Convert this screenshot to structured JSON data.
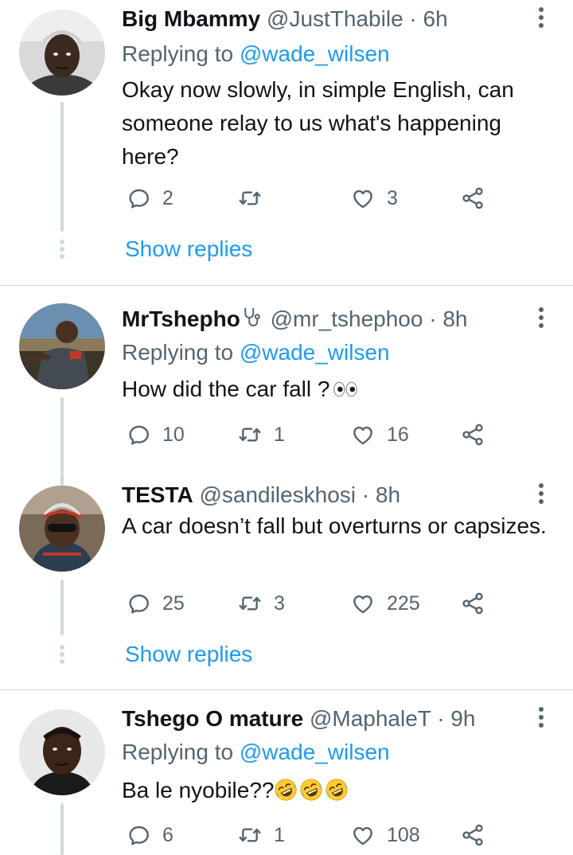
{
  "tweets": [
    {
      "name": "Big Mbammy",
      "handle": "@JustThabile",
      "time": "· 6h",
      "replying_prefix": "Replying to",
      "replying_to": "@wade_wilsen",
      "text": "Okay now slowly, in simple English, can someone relay to us what's happening here?",
      "replies": "2",
      "retweets": "",
      "likes": "3",
      "show_replies": "Show replies"
    },
    {
      "name": "MrTshepho",
      "name_emoji": "stethoscope-emoji",
      "handle": "@mr_tshephoo",
      "time": "· 8h",
      "replying_prefix": "Replying to",
      "replying_to": "@wade_wilsen",
      "text": "How did the car fall ?",
      "text_emoji": "eyes-emoji",
      "replies": "10",
      "retweets": "1",
      "likes": "16"
    },
    {
      "name": "TESTA",
      "handle": "@sandileskhosi",
      "time": "· 8h",
      "text": "A car doesn’t fall but overturns or capsizes.",
      "replies": "25",
      "retweets": "3",
      "likes": "225",
      "show_replies": "Show replies"
    },
    {
      "name": "Tshego O mature",
      "handle": "@MaphaleT",
      "time": "· 9h",
      "replying_prefix": "Replying to",
      "replying_to": "@wade_wilsen",
      "text": "Ba le nyobile??",
      "text_emoji": "rofl-emoji x3",
      "replies": "6",
      "retweets": "1",
      "likes": "108"
    }
  ],
  "icons": {
    "reply": "reply-icon",
    "retweet": "retweet-icon",
    "like": "like-icon",
    "share": "share-icon",
    "more": "more-icon"
  },
  "colors": {
    "text": "#0f1419",
    "secondary": "#536471",
    "accent": "#1d9bf0",
    "line": "#cfd9de"
  }
}
